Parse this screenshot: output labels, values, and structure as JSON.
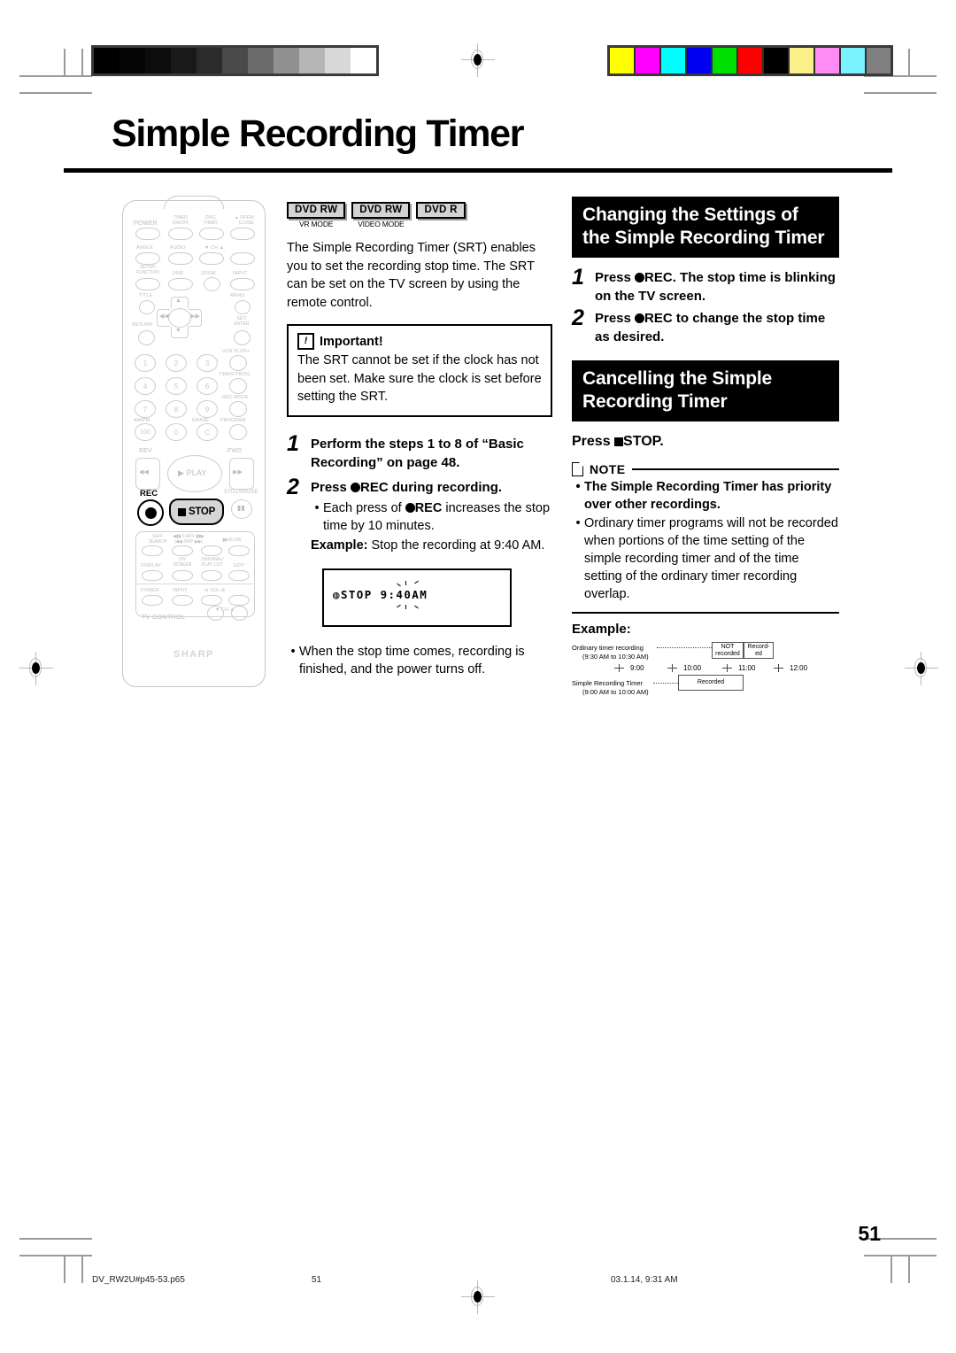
{
  "page": {
    "title": "Simple Recording Timer",
    "page_number": "51"
  },
  "printer_marks": {
    "grayscale_steps": [
      "#000000",
      "#050505",
      "#0c0c0c",
      "#191919",
      "#2b2b2b",
      "#4a4a4a",
      "#6b6b6b",
      "#919191",
      "#b5b5b5",
      "#d8d8d8",
      "#ffffff"
    ],
    "color_bar": [
      "#ffff00",
      "#ff00ff",
      "#00ffff",
      "#0000f0",
      "#00e000",
      "#ff0000",
      "#000000",
      "#fbf08a",
      "#ff8cf5",
      "#79f2ff",
      "#808080"
    ]
  },
  "badges": [
    {
      "chip": "DVD RW",
      "sub": "VR MODE"
    },
    {
      "chip": "DVD RW",
      "sub": "VIDEO MODE"
    },
    {
      "chip": "DVD R",
      "sub": ""
    }
  ],
  "intro": "The Simple Recording Timer (SRT) enables you to set the recording stop time. The SRT can be set on the TV screen by using the remote control.",
  "important": {
    "icon": "exclamation-icon",
    "heading": "Important!",
    "body": "The SRT cannot be set if the clock has not been set. Make sure the clock is set before setting the SRT."
  },
  "steps": [
    {
      "num": "1",
      "text": "Perform the steps 1 to 8 of “Basic Recording” on page 48."
    },
    {
      "num": "2",
      "text_pre": "Press ",
      "rec": "REC",
      "text_post": " during recording.",
      "bullet_pre": "Each press of ",
      "bullet_rec": "REC",
      "bullet_post": " increases the stop time by 10 minutes.",
      "example_label": "Example:",
      "example_text": " Stop the recording at 9:40 AM."
    }
  ],
  "osd": {
    "text": "STOP 9:40AM",
    "icon": "stop-indicator-icon"
  },
  "after_note": "When the stop time comes, recording is finished, and the power turns off.",
  "section_changing": {
    "heading": "Changing the Settings of the Simple Recording Timer",
    "steps": [
      {
        "num": "1",
        "pre": "Press ",
        "rec": "REC",
        "post": ". The stop time is blinking on the TV screen."
      },
      {
        "num": "2",
        "pre": "Press ",
        "rec": "REC",
        "post": " to change the stop time as desired."
      }
    ]
  },
  "section_cancelling": {
    "heading": "Cancelling the Simple Recording Timer",
    "press_pre": "Press ",
    "press_post": "STOP."
  },
  "note": {
    "label": "NOTE",
    "icon": "note-page-icon",
    "items": [
      {
        "text": "The Simple Recording Timer has priority over other recordings.",
        "bold": true
      },
      {
        "text": "Ordinary timer programs will not be recorded when portions of the time setting of the simple recording timer and of the time setting of the ordinary timer recording overlap.",
        "bold": false
      }
    ]
  },
  "example": {
    "label": "Example:",
    "row1_label": "Ordinary timer recording",
    "row1_sub": "(9:30 AM to 10:30 AM)",
    "row2_label": "Simple Recording Timer",
    "row2_sub": "(9:00 AM to 10:00 AM)",
    "box_not_recorded": "NOT recorded",
    "box_recorded_split": "Record- ed",
    "box_recorded": "Recorded",
    "times": [
      "9:00",
      "10:00",
      "11:00",
      "12:00"
    ]
  },
  "remote": {
    "brand": "SHARP",
    "row1": [
      "POWER",
      "TIMER ON/OFF",
      "DISC TIMER",
      "OPEN/ CLOSE"
    ],
    "row2": [
      "ANGLE",
      "AUDIO",
      "CH"
    ],
    "row3": [
      "SETUP/ FUNCTION",
      "DNR",
      "ZOOM",
      "INPUT"
    ],
    "row4": [
      "TITLE",
      "MENU"
    ],
    "navigation": [
      "RETURN",
      "SET/ ENTER"
    ],
    "numbers": [
      "1",
      "2",
      "3",
      "4",
      "5",
      "6",
      "7",
      "8",
      "9",
      "100",
      "0",
      "C"
    ],
    "side_labels": [
      "VCR PLUS+",
      "TIMER PROG.",
      "REC MODE",
      "PROGRAM",
      "AM/PM",
      "ERASE"
    ],
    "transport": [
      "REV",
      "PLAY",
      "FWD",
      "REC",
      "STOP",
      "STILL/PAUSE"
    ],
    "bottom_row1": [
      "SKIP SEARCH",
      "F.ADV SKIP",
      "SLOW"
    ],
    "bottom_row2": [
      "DISPLAY",
      "ON SCREEN",
      "ORIGINAL/ PLAY LIST",
      "EDIT"
    ],
    "tv_control": [
      "POWER",
      "INPUT",
      "VOL",
      "CH",
      "TV CONTROL"
    ]
  },
  "footer": {
    "file": "DV_RW2U#p45-53.p65",
    "page": "51",
    "timestamp": "03.1.14, 9:31 AM"
  }
}
